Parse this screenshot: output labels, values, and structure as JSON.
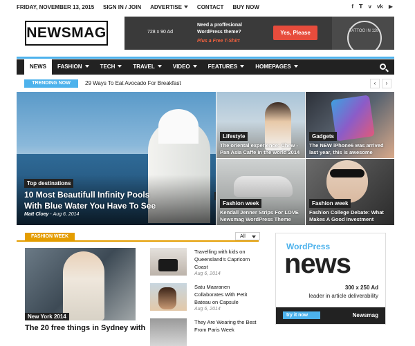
{
  "topbar": {
    "date": "FRIDAY, NOVEMBER 13, 2015",
    "links": [
      "SIGN IN / JOIN",
      "ADVERTISE",
      "CONTACT",
      "BUY NOW"
    ],
    "social_icons": [
      "facebook-icon",
      "twitter-icon",
      "vimeo-icon",
      "vk-icon",
      "youtube-icon"
    ]
  },
  "logo": "NEWSMAG",
  "ad_banner": {
    "size": "728 x 90 Ad",
    "line1": "Need a proffesional WordPress theme?",
    "line2": "Plus a Free T-Shirt",
    "button": "Yes, Please",
    "shirt_text": "TATTOO IN 12th"
  },
  "nav": {
    "items": [
      "NEWS",
      "FASHION",
      "TECH",
      "TRAVEL",
      "VIDEO",
      "FEATURES",
      "HOMEPAGES"
    ],
    "active": "NEWS"
  },
  "trending": {
    "label": "TRENDING NOW",
    "text": "29 Ways To Eat Avocado For Breakfast"
  },
  "featured": {
    "big": {
      "category": "Top destinations",
      "title_line1": "10 Most Beautifull Infinity Pools",
      "title_line2": "With Blue Water You Have To See",
      "author": "Matt Cloey",
      "date": "Aug 6, 2014",
      "count": "3"
    },
    "tiles": [
      {
        "category": "Lifestyle",
        "title_line1": "The oriental experience: Chew -",
        "title_line2": "Pan Asia Caffe in the world 2014"
      },
      {
        "category": "Gadgets",
        "title_line1": "The NEW iPhone6 was arrived",
        "title_line2": "last year, this is awesome"
      },
      {
        "category": "Fashion week",
        "title_line1": "Kendall Jenner Strips For LOVE",
        "title_line2": "Newsmag WordPress Theme"
      },
      {
        "category": "Fashion week",
        "title_line1": "Fashion College Debate: What",
        "title_line2": "Makes A Good Investment"
      }
    ]
  },
  "section": {
    "label": "FASHION WEEK",
    "filter": "All",
    "main": {
      "category": "New York 2014",
      "title": "The 20 free things in Sydney with"
    },
    "list": [
      {
        "title_line1": "Travelling with kids on",
        "title_line2": "Queensland's Capricorn",
        "title_line3": "Coast",
        "date": "Aug 6, 2014"
      },
      {
        "title_line1": "Satu Maaranen",
        "title_line2": "Collaborates With Petit",
        "title_line3": "Bateau on Capsule",
        "date": "Aug 6, 2014"
      },
      {
        "title_line1": "They Are Wearing the Best",
        "title_line2": "From Paris Week",
        "title_line3": "",
        "date": ""
      }
    ]
  },
  "side_ad": {
    "line1": "WordPress",
    "line2": "news",
    "size": "300 x 250 Ad",
    "slogan": "leader in article deliverability",
    "button": "try it now",
    "brand": "Newsmag"
  },
  "colors": {
    "accent": "#4db2ec",
    "section": "#e49d00",
    "ad_button": "#e74c3c",
    "nav_bg": "#222222"
  }
}
